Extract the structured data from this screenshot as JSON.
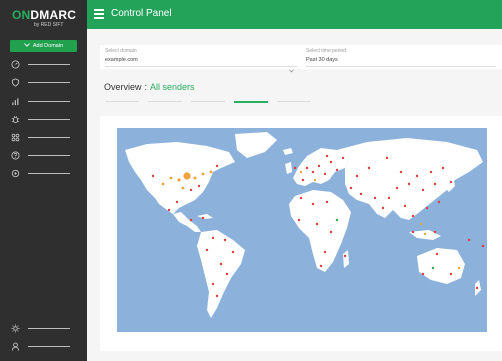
{
  "app": {
    "logo_prefix": "ON",
    "logo_main": "DMARC",
    "logo_sub": "by RED SIFT"
  },
  "sidebar": {
    "add_domain_label": "Add Domain",
    "items": [
      {
        "icon": "gauge-icon"
      },
      {
        "icon": "shield-icon"
      },
      {
        "icon": "bar-chart-icon"
      },
      {
        "icon": "bug-icon"
      },
      {
        "icon": "grid-icon"
      },
      {
        "icon": "help-icon"
      },
      {
        "icon": "target-icon"
      }
    ],
    "bottom_items": [
      {
        "icon": "sun-icon"
      },
      {
        "icon": "user-icon"
      }
    ]
  },
  "header": {
    "title": "Control Panel"
  },
  "filters": {
    "domain_label": "Select domain",
    "domain_value": "example.com",
    "period_label": "Select time period",
    "period_value": "Past 30 days"
  },
  "overview": {
    "label": "Overview",
    "separator": ":",
    "value": "All senders",
    "tab_count": 5,
    "active_tab_index": 3
  },
  "map": {
    "ocean_color": "#8cb2dc",
    "land_color": "#ffffff",
    "dot_colors": {
      "red": "#e23b3b",
      "orange": "#f0a33a",
      "green": "#2fa84f"
    }
  }
}
